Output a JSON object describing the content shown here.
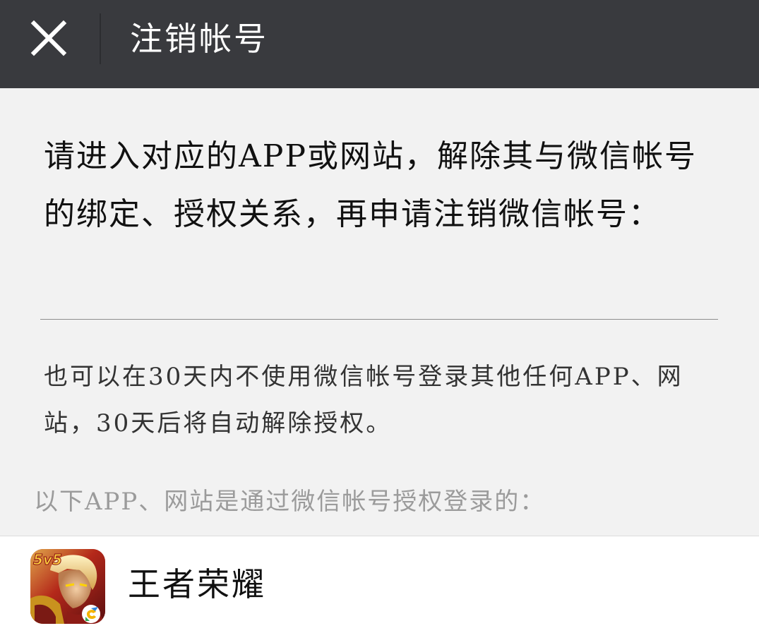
{
  "header": {
    "close_icon": "close-icon",
    "title": "注销帐号"
  },
  "instruction": {
    "text": "请进入对应的APP或网站，解除其与微信帐号的绑定、授权关系，再申请注销微信帐号："
  },
  "note": {
    "text": "也可以在30天内不使用微信帐号登录其他任何APP、网站，30天后将自动解除授权。"
  },
  "section": {
    "label": "以下APP、网站是通过微信帐号授权登录的："
  },
  "apps": [
    {
      "name": "王者荣耀",
      "icon": "honor-of-kings-app-icon",
      "icon_badge": "5v5"
    }
  ],
  "colors": {
    "header_bg": "#393a3e",
    "page_bg": "#f2f2f2",
    "list_bg": "#ffffff",
    "text_primary": "#111111",
    "text_secondary": "#333333",
    "text_muted": "#9b9b9b"
  }
}
